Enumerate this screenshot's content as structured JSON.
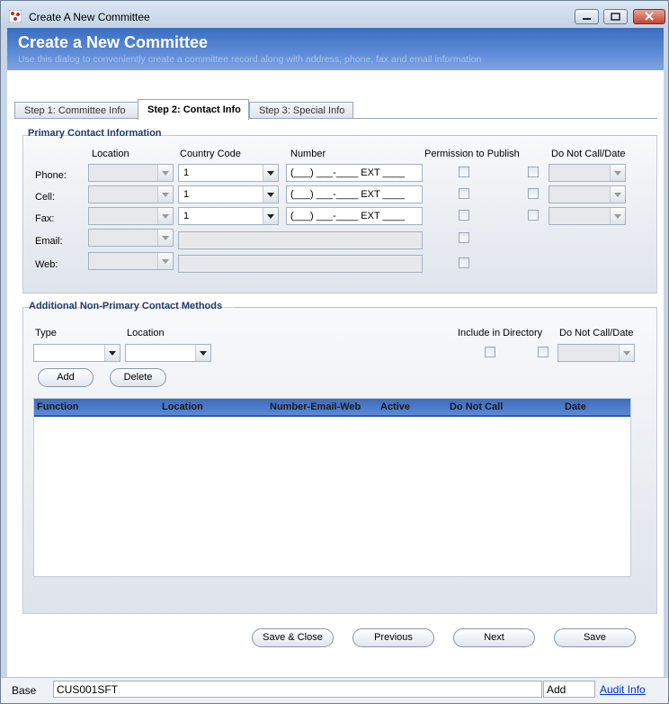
{
  "window": {
    "title": "Create A New Committee"
  },
  "header": {
    "title": "Create a New Committee",
    "subtitle": "Use this dialog to conveniently create a committee record along with address, phone, fax and email information"
  },
  "tabs": [
    {
      "label": "Step 1: Committee Info",
      "active": false
    },
    {
      "label": "Step 2: Contact Info",
      "active": true
    },
    {
      "label": "Step 3: Special Info",
      "active": false
    }
  ],
  "primary": {
    "title": "Primary Contact Information",
    "col_location": "Location",
    "col_country": "Country Code",
    "col_number": "Number",
    "col_permission": "Permission to Publish",
    "col_dnc": "Do Not Call/Date",
    "rows": [
      {
        "label": "Phone:",
        "country": "1",
        "number": "(___) ___-____ EXT ____"
      },
      {
        "label": "Cell:",
        "country": "1",
        "number": "(___) ___-____ EXT ____"
      },
      {
        "label": "Fax:",
        "country": "1",
        "number": "(___) ___-____ EXT ____"
      },
      {
        "label": "Email:"
      },
      {
        "label": "Web:"
      }
    ]
  },
  "additional": {
    "title": "Additional Non-Primary Contact Methods",
    "type_label": "Type",
    "location_label": "Location",
    "include_label": "Include in Directory",
    "dnc_label": "Do Not Call/Date",
    "add_button": "Add",
    "delete_button": "Delete",
    "grid_columns": [
      "Function",
      "Location",
      "Number-Email-Web",
      "Active",
      "Do Not Call",
      "Date"
    ]
  },
  "footer": {
    "save_close": "Save & Close",
    "previous": "Previous",
    "next": "Next",
    "save": "Save"
  },
  "status": {
    "base_label": "Base",
    "user": "CUS001SFT",
    "mode": "Add",
    "audit_link": "Audit Info"
  },
  "colors": {
    "header_blue": "#3a6cc0",
    "link": "#0033cc"
  }
}
